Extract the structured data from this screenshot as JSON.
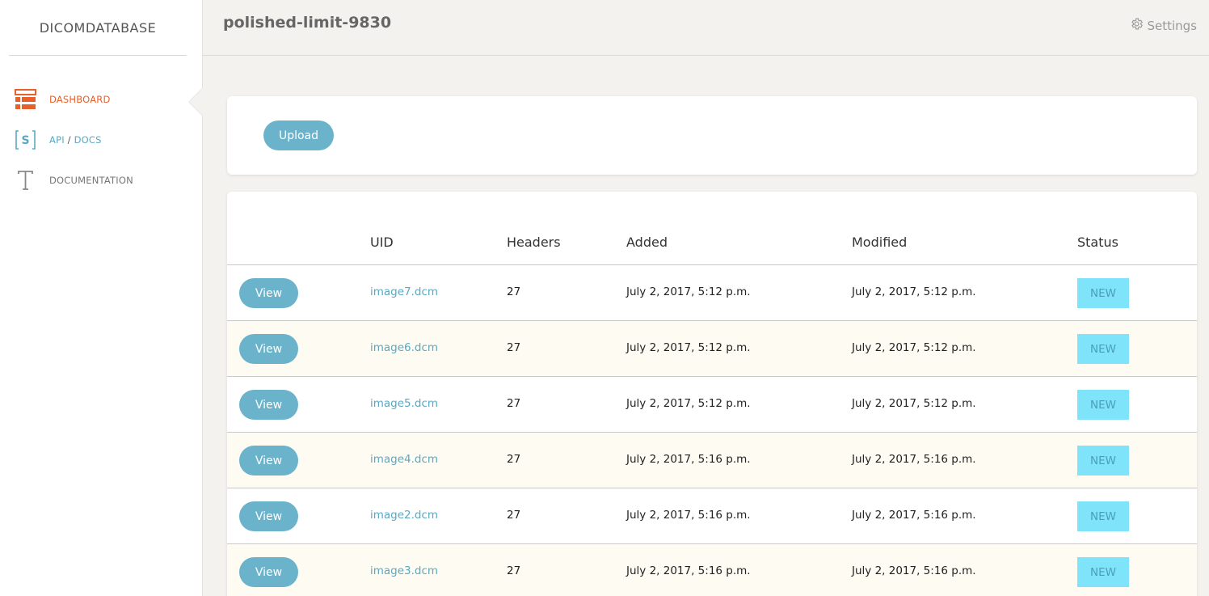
{
  "app": {
    "brand": "DICOMDATABASE",
    "page_title": "polished-limit-9830",
    "settings_label": "Settings"
  },
  "sidebar": {
    "dashboard": "DASHBOARD",
    "api": "API",
    "api_sep": "/",
    "docs": "DOCS",
    "documentation": "DOCUMENTATION"
  },
  "upload": {
    "label": "Upload"
  },
  "table": {
    "headers": {
      "uid": "UID",
      "headers": "Headers",
      "added": "Added",
      "modified": "Modified",
      "status": "Status"
    },
    "rows": [
      {
        "view": "View",
        "uid": "image7.dcm",
        "headers": "27",
        "added": "July 2, 2017, 5:12 p.m.",
        "modified": "July 2, 2017, 5:12 p.m.",
        "status": "NEW"
      },
      {
        "view": "View",
        "uid": "image6.dcm",
        "headers": "27",
        "added": "July 2, 2017, 5:12 p.m.",
        "modified": "July 2, 2017, 5:12 p.m.",
        "status": "NEW"
      },
      {
        "view": "View",
        "uid": "image5.dcm",
        "headers": "27",
        "added": "July 2, 2017, 5:12 p.m.",
        "modified": "July 2, 2017, 5:12 p.m.",
        "status": "NEW"
      },
      {
        "view": "View",
        "uid": "image4.dcm",
        "headers": "27",
        "added": "July 2, 2017, 5:16 p.m.",
        "modified": "July 2, 2017, 5:16 p.m.",
        "status": "NEW"
      },
      {
        "view": "View",
        "uid": "image2.dcm",
        "headers": "27",
        "added": "July 2, 2017, 5:16 p.m.",
        "modified": "July 2, 2017, 5:16 p.m.",
        "status": "NEW"
      },
      {
        "view": "View",
        "uid": "image3.dcm",
        "headers": "27",
        "added": "July 2, 2017, 5:16 p.m.",
        "modified": "July 2, 2017, 5:16 p.m.",
        "status": "NEW"
      }
    ]
  },
  "colors": {
    "accent": "#6ab3cb",
    "active": "#e8612b",
    "status_new": "#7fe3fa",
    "link": "#5aa9c3"
  },
  "icons": {
    "dashboard": "dashboard-icon",
    "api": "api-docs-icon",
    "documentation": "documentation-icon",
    "settings": "gear-icon"
  }
}
